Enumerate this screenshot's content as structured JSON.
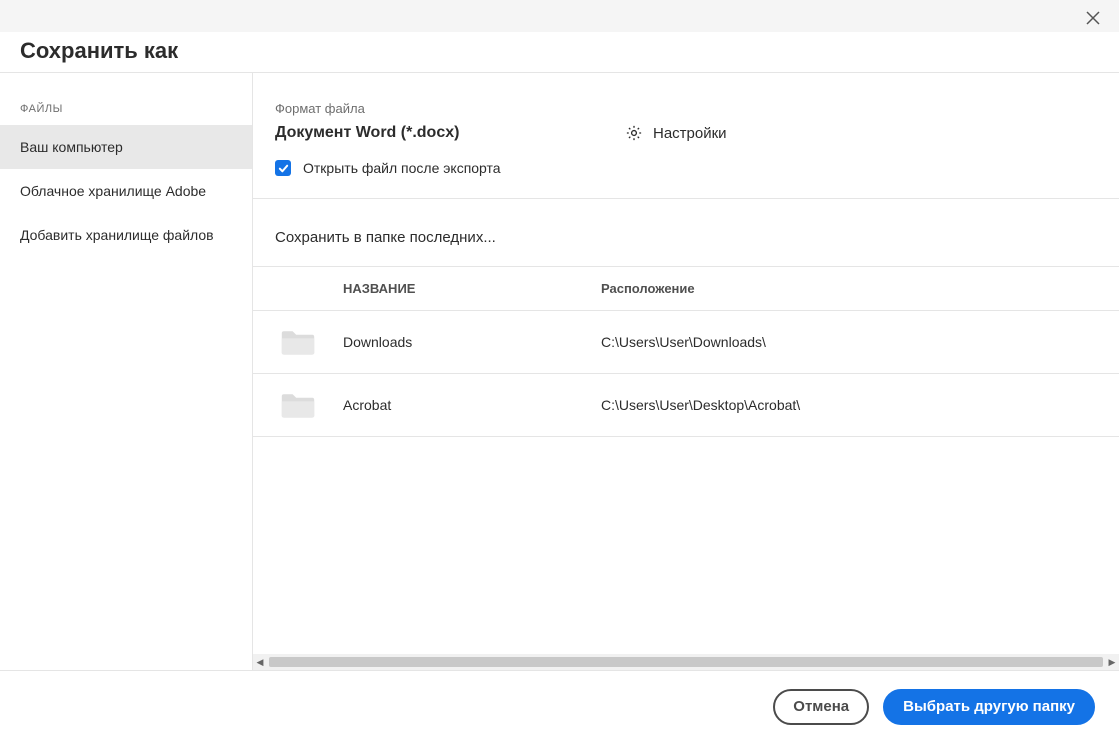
{
  "dialog": {
    "title": "Сохранить как",
    "close_aria": "Закрыть"
  },
  "sidebar": {
    "section_label": "ФАЙЛЫ",
    "items": [
      {
        "label": "Ваш компьютер",
        "active": true
      },
      {
        "label": "Облачное хранилище Adobe",
        "active": false
      },
      {
        "label": "Добавить хранилище файлов",
        "active": false
      }
    ]
  },
  "format": {
    "label": "Формат файла",
    "value": "Документ Word (*.docx)",
    "settings_label": "Настройки"
  },
  "open_after": {
    "checked": true,
    "label": "Открыть файл после экспорта"
  },
  "recent": {
    "label": "Сохранить в папке последних...",
    "columns": {
      "name": "НАЗВАНИЕ",
      "location": "Расположение"
    },
    "folders": [
      {
        "name": "Downloads",
        "location": "C:\\Users\\User\\Downloads\\"
      },
      {
        "name": "Acrobat",
        "location": "C:\\Users\\User\\Desktop\\Acrobat\\"
      }
    ]
  },
  "footer": {
    "cancel": "Отмена",
    "choose_other": "Выбрать другую папку"
  },
  "colors": {
    "accent": "#1473e6"
  }
}
